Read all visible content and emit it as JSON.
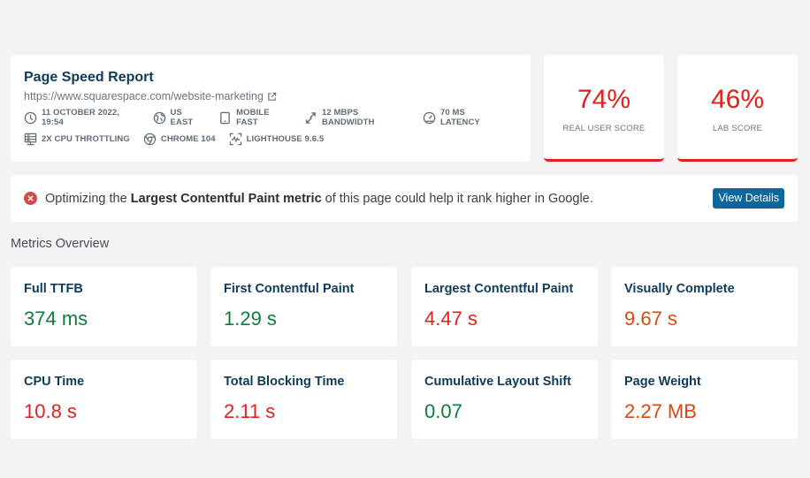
{
  "report": {
    "title": "Page Speed Report",
    "url": "https://www.squarespace.com/website-marketing",
    "meta_row1": [
      {
        "icon": "clock-icon",
        "label": "11 OCTOBER 2022, 19:54"
      },
      {
        "icon": "globe-icon",
        "label": "US EAST"
      },
      {
        "icon": "mobile-icon",
        "label": "MOBILE FAST"
      },
      {
        "icon": "bandwidth-icon",
        "label": "12 MBPS BANDWIDTH"
      },
      {
        "icon": "latency-gauge-icon",
        "label": "70 MS LATENCY"
      }
    ],
    "meta_row2": [
      {
        "icon": "cpu-server-icon",
        "label": "2X CPU THROTTLING"
      },
      {
        "icon": "chrome-icon",
        "label": "CHROME 104"
      },
      {
        "icon": "lighthouse-icon",
        "label": "LIGHTHOUSE 9.6.5"
      }
    ]
  },
  "scores": {
    "real_user": {
      "value": "74%",
      "label": "REAL USER SCORE"
    },
    "lab": {
      "value": "46%",
      "label": "LAB SCORE"
    },
    "status_color": "#e0201b"
  },
  "alert": {
    "text_before": "Optimizing the ",
    "text_bold": "Largest Contentful Paint metric",
    "text_after": " of this page could help it rank higher in Google.",
    "button_label": "View Details"
  },
  "metrics": {
    "section_title": "Metrics Overview",
    "items": [
      {
        "label": "Full TTFB",
        "value": "374 ms",
        "status": "good"
      },
      {
        "label": "First Contentful Paint",
        "value": "1.29 s",
        "status": "good"
      },
      {
        "label": "Largest Contentful Paint",
        "value": "4.47 s",
        "status": "poor"
      },
      {
        "label": "Visually Complete",
        "value": "9.67 s",
        "status": "warn"
      },
      {
        "label": "CPU Time",
        "value": "10.8 s",
        "status": "poor"
      },
      {
        "label": "Total Blocking Time",
        "value": "2.11 s",
        "status": "poor"
      },
      {
        "label": "Cumulative Layout Shift",
        "value": "0.07",
        "status": "good"
      },
      {
        "label": "Page Weight",
        "value": "2.27 MB",
        "status": "warn"
      }
    ]
  },
  "colors": {
    "good": "#0c7c3b",
    "poor": "#e0201b",
    "warn": "#d24a0e",
    "accent_button": "#0e6699",
    "title": "#0f3b5a"
  }
}
